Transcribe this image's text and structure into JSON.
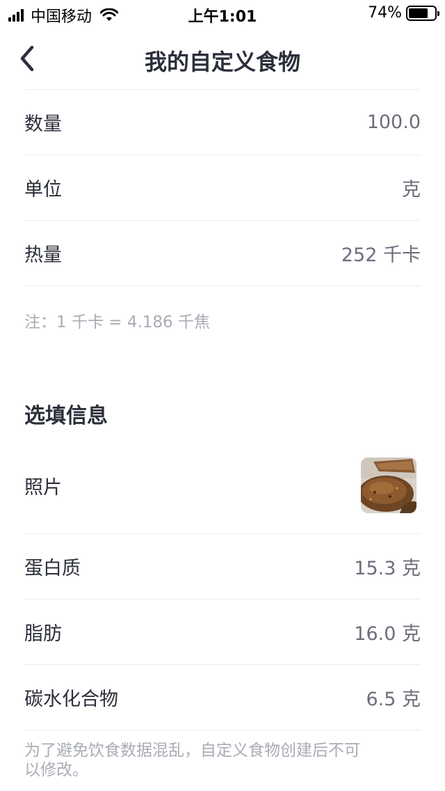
{
  "status_bar": {
    "carrier": "中国移动",
    "time": "上午1:01",
    "battery_text": "74%",
    "battery_level": 0.74
  },
  "nav": {
    "title": "我的自定义食物"
  },
  "basic_rows": [
    {
      "label": "数量",
      "value": "100.0"
    },
    {
      "label": "单位",
      "value": "克"
    },
    {
      "label": "热量",
      "value": "252 千卡"
    }
  ],
  "energy_note": "注：1 千卡 = 4.186 千焦",
  "optional_section": {
    "title": "选填信息",
    "photo_label": "照片",
    "rows": [
      {
        "label": "蛋白质",
        "value": "15.3 克"
      },
      {
        "label": "脂肪",
        "value": "16.0 克"
      },
      {
        "label": "碳水化合物",
        "value": "6.5 克"
      }
    ]
  },
  "footer_note": "为了避免饮食数据混乱，自定义食物创建后不可以修改。"
}
